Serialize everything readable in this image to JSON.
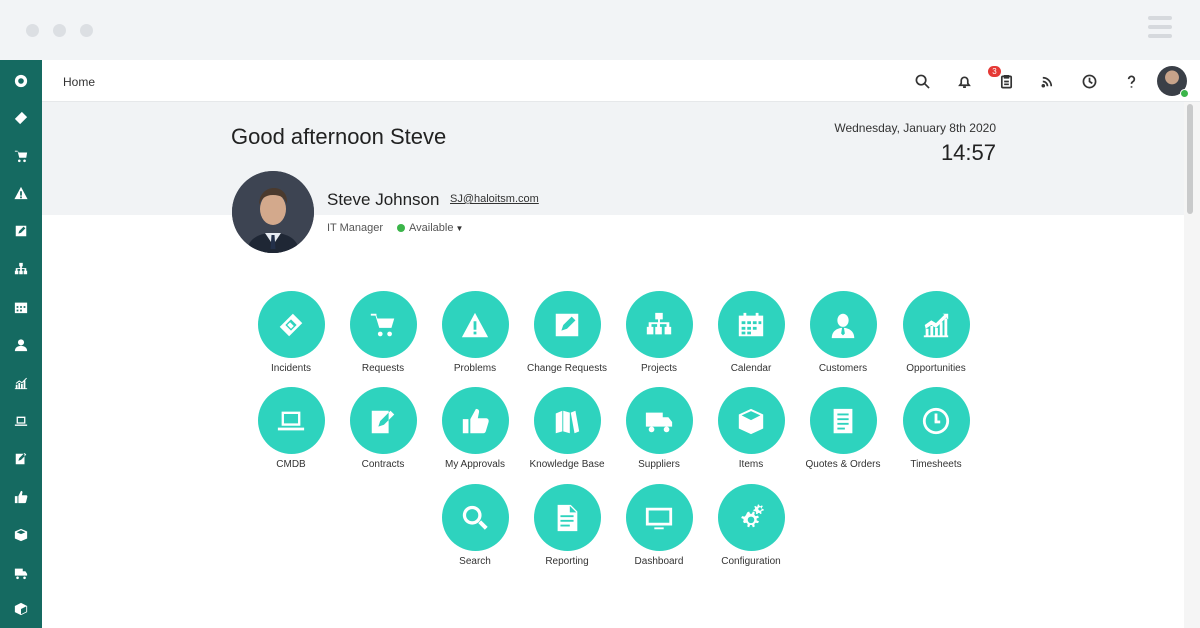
{
  "topbar": {
    "breadcrumb": "Home",
    "notification_count": "3"
  },
  "greeting": "Good afternoon Steve",
  "date": "Wednesday, January 8th 2020",
  "time": "14:57",
  "profile": {
    "name": "Steve Johnson",
    "email": "SJ@haloitsm.com",
    "role": "IT Manager",
    "status": "Available"
  },
  "colors": {
    "sidebar": "#156a61",
    "tile": "#2ed3be",
    "status_green": "#3bb54a",
    "badge": "#e53935"
  },
  "sidebar_icons": [
    "home-icon",
    "ticket-icon",
    "cart-icon",
    "warning-icon",
    "edit-icon",
    "hierarchy-icon",
    "calendar-icon",
    "user-icon",
    "chart-icon",
    "laptop-icon",
    "contract-icon",
    "thumbs-up-icon",
    "box-icon",
    "truck-icon",
    "cube-icon"
  ],
  "tiles": [
    {
      "label": "Incidents",
      "icon": "ticket-icon"
    },
    {
      "label": "Requests",
      "icon": "cart-icon"
    },
    {
      "label": "Problems",
      "icon": "warning-icon"
    },
    {
      "label": "Change Requests",
      "icon": "edit-icon"
    },
    {
      "label": "Projects",
      "icon": "hierarchy-icon"
    },
    {
      "label": "Calendar",
      "icon": "calendar-icon"
    },
    {
      "label": "Customers",
      "icon": "user-icon"
    },
    {
      "label": "Opportunities",
      "icon": "chart-icon"
    },
    {
      "label": "CMDB",
      "icon": "laptop-icon"
    },
    {
      "label": "Contracts",
      "icon": "contract-icon"
    },
    {
      "label": "My Approvals",
      "icon": "thumbs-up-icon"
    },
    {
      "label": "Knowledge Base",
      "icon": "books-icon"
    },
    {
      "label": "Suppliers",
      "icon": "truck-icon"
    },
    {
      "label": "Items",
      "icon": "box-icon"
    },
    {
      "label": "Quotes & Orders",
      "icon": "document-icon"
    },
    {
      "label": "Timesheets",
      "icon": "clock-icon"
    },
    {
      "label": "Search",
      "icon": "search-icon"
    },
    {
      "label": "Reporting",
      "icon": "report-icon"
    },
    {
      "label": "Dashboard",
      "icon": "monitor-icon"
    },
    {
      "label": "Configuration",
      "icon": "gears-icon"
    }
  ]
}
